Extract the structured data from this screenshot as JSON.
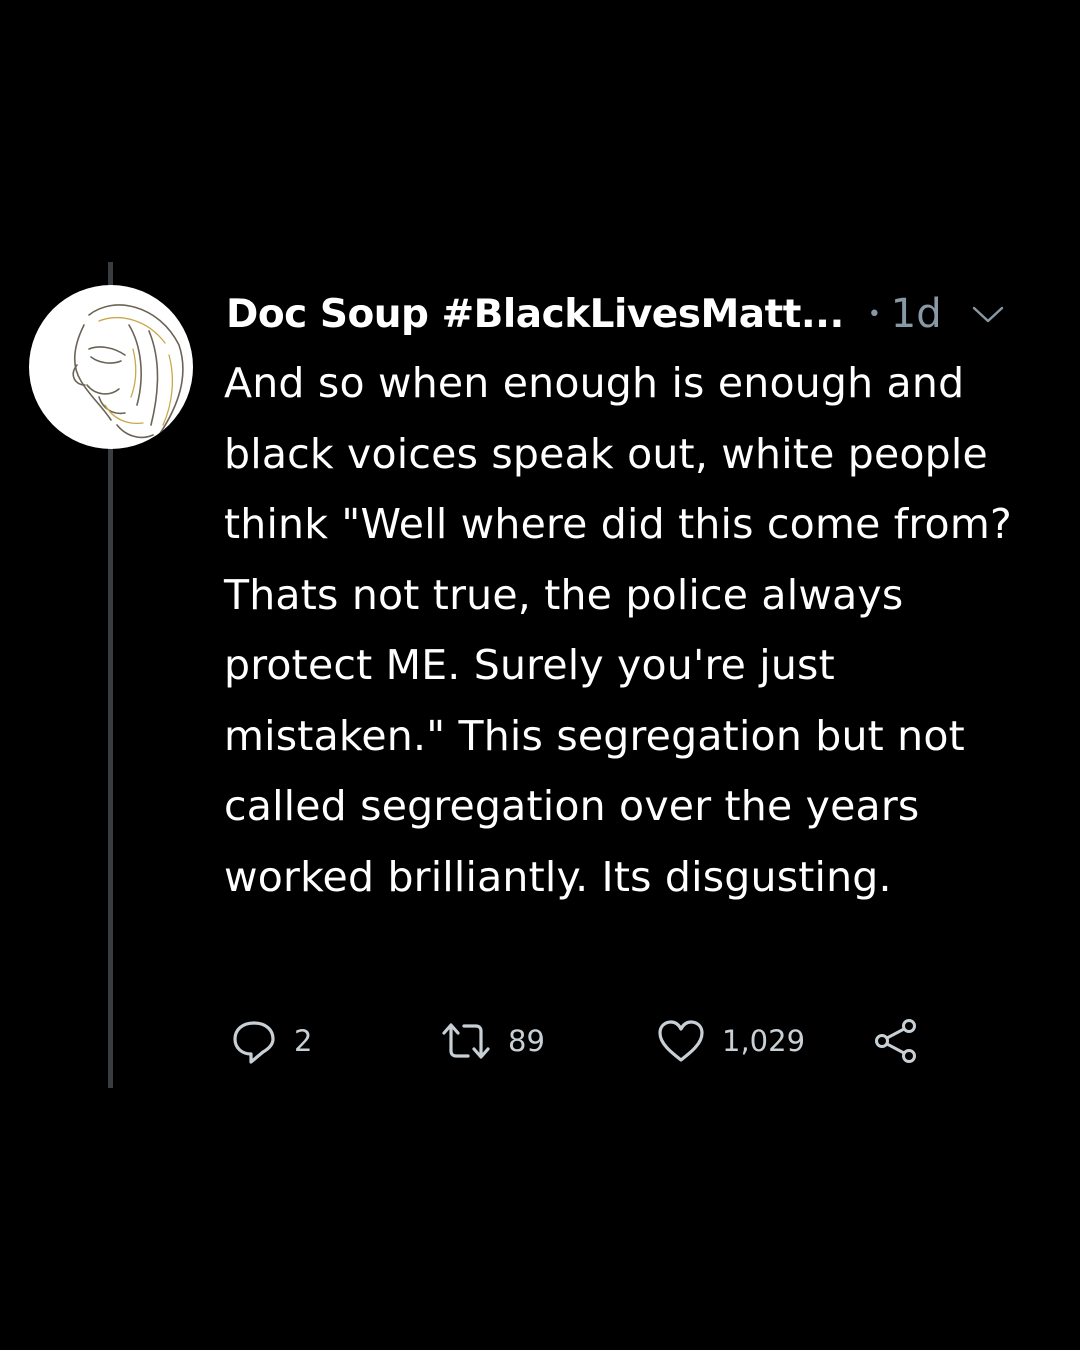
{
  "tweet": {
    "author_name": "Doc Soup #BlackLivesMatt...",
    "separator": "•",
    "timestamp": "1d",
    "text": "And so when enough is enough and black voices speak out, white people think \"Well where did this come from? Thats not true, the police always protect ME. Surely you're just mistaken.\" This segregation but not called segregation over the years worked brilliantly. Its disgusting."
  },
  "actions": {
    "reply_count": "2",
    "retweet_count": "89",
    "like_count": "1,029"
  },
  "icons": {
    "avatar": "sketch-avatar",
    "menu": "chevron-down-icon",
    "reply": "reply-icon",
    "retweet": "retweet-icon",
    "like": "heart-icon",
    "share": "share-icon"
  },
  "colors": {
    "background": "#000000",
    "text": "#ffffff",
    "secondary": "#8899a6",
    "thread_line": "#3a3d40"
  }
}
